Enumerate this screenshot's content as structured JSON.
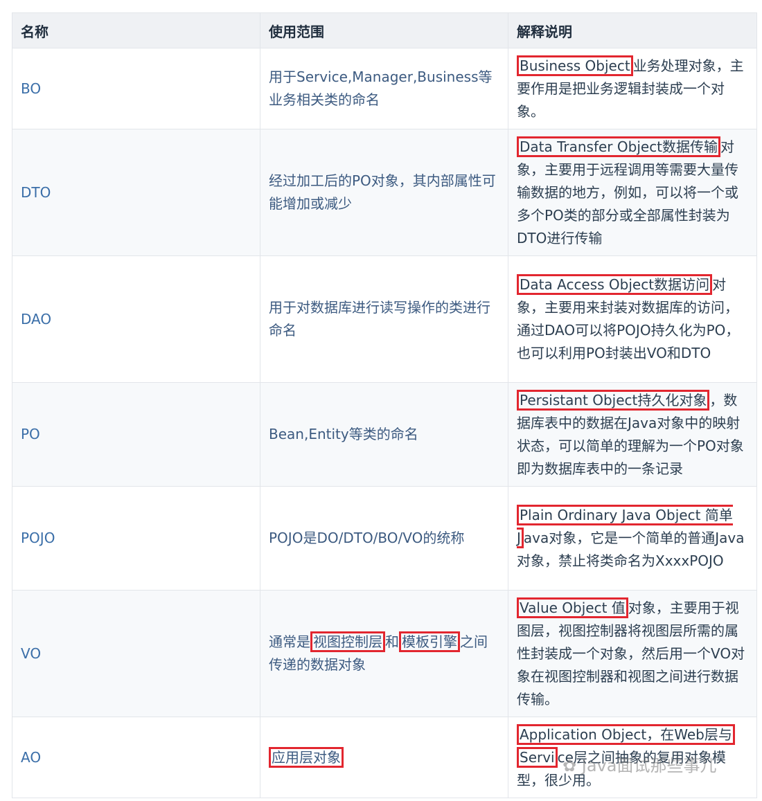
{
  "headers": [
    "名称",
    "使用范围",
    "解释说明"
  ],
  "rows": [
    {
      "name": "BO",
      "usage": "用于Service,Manager,Business等业务相关类的命名",
      "desc_hl": "Business Object",
      "desc_rest": "业务处理对象，主要作用是把业务逻辑封装成一个对象。"
    },
    {
      "name": "DTO",
      "usage": "经过加工后的PO对象，其内部属性可能增加或减少",
      "desc_hl": "Data Transfer Object数据传输",
      "desc_rest": "对象，主要用于远程调用等需要大量传输数据的地方，例如，可以将一个或多个PO类的部分或全部属性封装为DTO进行传输"
    },
    {
      "name": "DAO",
      "usage": "用于对数据库进行读写操作的类进行命名",
      "desc_hl": "Data Access Object数据访问",
      "desc_rest": "对象，主要用来封装对数据库的访问，通过DAO可以将POJO持久化为PO，也可以利用PO封装出VO和DTO"
    },
    {
      "name": "PO",
      "usage": "Bean,Entity等类的命名",
      "desc_hl": "Persistant Object持久化对象",
      "desc_rest": "，数据库表中的数据在Java对象中的映射状态，可以简单的理解为一个PO对象即为数据库表中的一条记录"
    },
    {
      "name": "POJO",
      "usage": "POJO是DO/DTO/BO/VO的统称",
      "desc_hl": "Plain Ordinary Java Object 简单J",
      "desc_rest": "ava对象，它是一个简单的普通Java对象，禁止将类命名为XxxxPOJO"
    },
    {
      "name": "VO",
      "usage_pre": "通常是",
      "usage_hl1": "视图控制层",
      "usage_mid": "和",
      "usage_hl2": "模板引擎",
      "usage_post": "之间传递的数据对象",
      "desc_hl": "Value Object 值",
      "desc_rest": "对象，主要用于视图层，视图控制器将视图层所需的属性封装成一个对象，然后用一个VO对象在视图控制器和视图之间进行数据传输。"
    },
    {
      "name": "AO",
      "usage": "应用层对象",
      "desc_hl": "Application Object，在Web层与",
      "desc_hl2": "Servi",
      "desc_rest": "ce层之间抽象的复用对象模型，很少用。"
    }
  ],
  "watermark": "Java面试那些事儿"
}
